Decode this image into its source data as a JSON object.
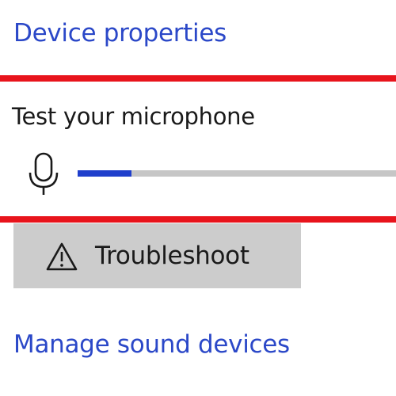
{
  "links": {
    "device_properties": "Device properties",
    "manage_sound_devices": "Manage sound devices"
  },
  "mic_test": {
    "title": "Test your microphone",
    "level_fraction": 0.17
  },
  "troubleshoot": {
    "label": "Troubleshoot",
    "icon": "warning-triangle-icon"
  },
  "colors": {
    "link": "#2b48c8",
    "highlight": "#e8141c",
    "level_fill": "#1f3fcc",
    "level_track": "#c6c6c6",
    "button_bg": "#cccccc"
  }
}
